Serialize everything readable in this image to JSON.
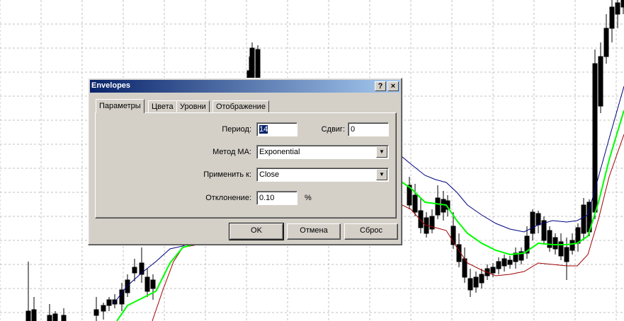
{
  "dialog": {
    "title": "Envelopes",
    "help_label": "?",
    "close_label": "×",
    "tabs": [
      {
        "label": "Параметры",
        "active": true
      },
      {
        "label": "Цвета",
        "active": false
      },
      {
        "label": "Уровни",
        "active": false
      },
      {
        "label": "Отображение",
        "active": false
      }
    ],
    "fields": {
      "period": {
        "label": "Период:",
        "value": "14"
      },
      "shift": {
        "label": "Сдвиг:",
        "value": "0"
      },
      "ma_method": {
        "label": "Метод МА:",
        "value": "Exponential"
      },
      "apply_to": {
        "label": "Применить к:",
        "value": "Close"
      },
      "deviation": {
        "label": "Отклонение:",
        "value": "0.10",
        "unit": "%"
      }
    },
    "buttons": {
      "ok": "OK",
      "cancel": "Отмена",
      "reset": "Сброс"
    }
  },
  "chart": {
    "colors": {
      "background": "#ffffff",
      "grid": "#c0c0c0",
      "candle": "#000000",
      "middle_line": "#00ff00",
      "upper_band": "#000080",
      "lower_band": "#a00000"
    }
  }
}
